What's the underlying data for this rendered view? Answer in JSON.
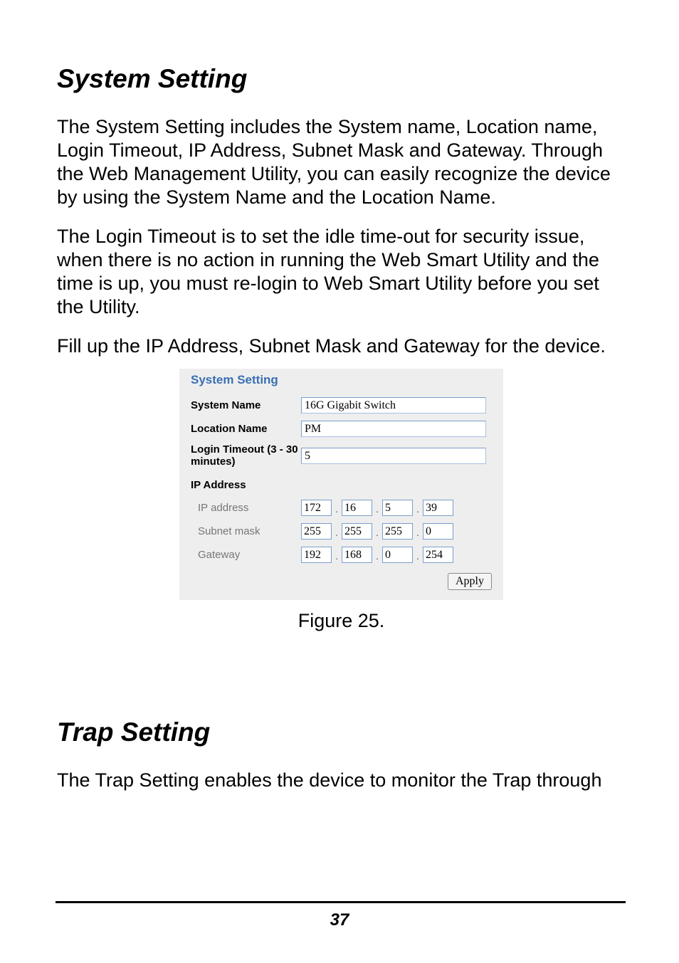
{
  "section1": {
    "heading": "System Setting",
    "p1": "The System Setting includes the System name, Location name, Login Timeout, IP Address, Subnet Mask and Gateway. Through the Web Management Utility, you can easily recognize the device by using the System Name and the Location Name.",
    "p2": "The Login Timeout is to set the idle time-out for security issue, when there is no action in running the Web Smart Utility and the time is up, you must re-login to Web Smart Utility before you set the Utility.",
    "p3": "Fill up the IP Address, Subnet Mask and Gateway for the device."
  },
  "panel": {
    "title": "System Setting",
    "labels": {
      "system_name": "System Name",
      "location_name": "Location Name",
      "login_timeout": "Login Timeout (3 - 30 minutes)",
      "ip_address_header": "IP Address",
      "ip_address": "IP address",
      "subnet_mask": "Subnet mask",
      "gateway": "Gateway"
    },
    "values": {
      "system_name": "16G Gigabit Switch",
      "location_name": "PM",
      "login_timeout": "5",
      "ip": [
        "172",
        "16",
        "5",
        "39"
      ],
      "subnet": [
        "255",
        "255",
        "255",
        "0"
      ],
      "gateway": [
        "192",
        "168",
        "0",
        "254"
      ]
    },
    "apply_label": "Apply"
  },
  "caption": "Figure 25.",
  "section2": {
    "heading": "Trap Setting",
    "p1": "The Trap Setting enables the device to monitor the Trap through"
  },
  "page_number": "37"
}
